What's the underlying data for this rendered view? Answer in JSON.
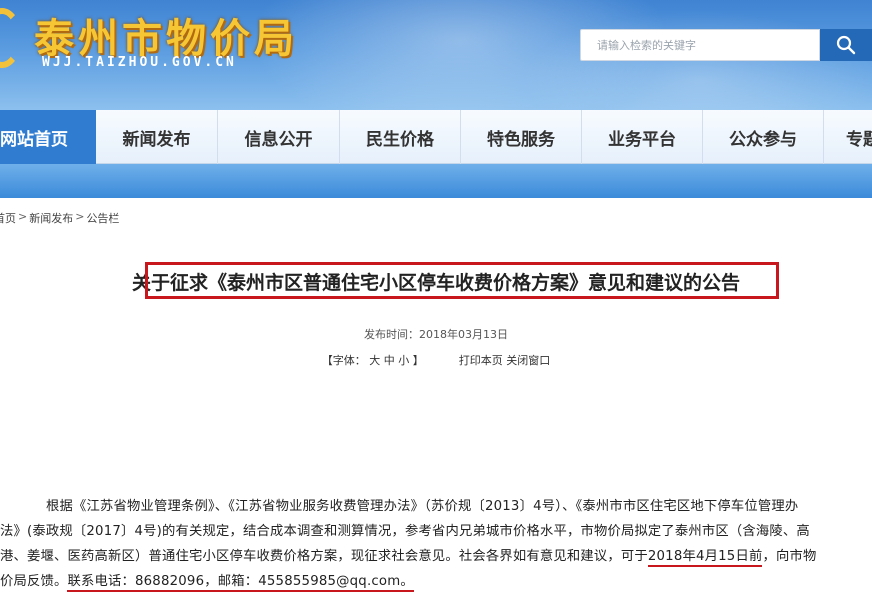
{
  "header": {
    "site_title": "泰州市物价局",
    "site_url": "WJJ.TAIZHOU.GOV.CN",
    "search_placeholder": "请输入检索的关键字"
  },
  "nav": {
    "items": [
      {
        "label": "网站首页",
        "active": true
      },
      {
        "label": "新闻发布",
        "active": false
      },
      {
        "label": "信息公开",
        "active": false
      },
      {
        "label": "民生价格",
        "active": false
      },
      {
        "label": "特色服务",
        "active": false
      },
      {
        "label": "业务平台",
        "active": false
      },
      {
        "label": "公众参与",
        "active": false
      },
      {
        "label": "专题",
        "active": false
      }
    ]
  },
  "breadcrumb": {
    "items": [
      "首页",
      "新闻发布",
      "公告栏"
    ],
    "separator": ">"
  },
  "article": {
    "title": "关于征求《泰州市区普通住宅小区停车收费价格方案》意见和建议的公告",
    "publish_label": "发布时间：",
    "publish_date": "2018年03月13日",
    "font_size_label": "【字体：",
    "font_large": "大",
    "font_medium": "中",
    "font_small": "小",
    "font_close": "】",
    "print_label": "打印本页",
    "close_label": "关闭窗口",
    "body": {
      "line1": "根据《江苏省物业管理条例》、《江苏省物业服务收费管理办法》（苏价规〔2013〕4号）、《泰州市市区住宅区地下停车位管理办",
      "line2": "法》(泰政规〔2017〕4号)的有关规定，结合成本调查和测算情况，参考省内兄弟城市价格水平，市物价局拟定了泰州市区（含海陵、高",
      "line3_a": "港、姜堰、医药高新区）普通住宅小区停车收费价格方案，现征求社会意见。社会各界如有意见和建议，可于",
      "line3_deadline": "2018年4月15日前",
      "line3_b": "，向市物",
      "line4_a": "价局反馈。",
      "line4_contact": "联系电话：86882096，邮箱：455855985@qq.com。"
    }
  },
  "colors": {
    "nav_active": "#2f7cd0",
    "highlight_red": "#c9171e",
    "title_gold": "#f6c634"
  }
}
